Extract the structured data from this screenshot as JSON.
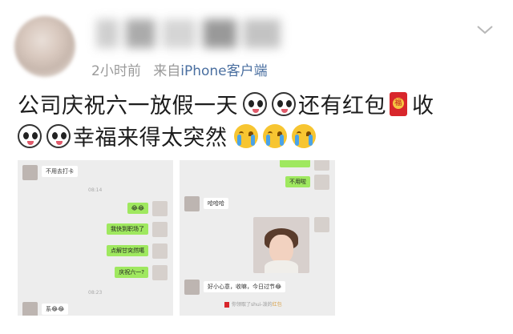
{
  "post": {
    "time": "2小时前",
    "source_prefix": "来自",
    "source_app": "iPhone客户端",
    "line1_a": "公司庆祝六一放假一天",
    "line1_b": "还有红包",
    "line1_c": "收",
    "line2": "幸福来得太突然"
  },
  "chat_left": {
    "msg1": "不用去打卡",
    "time1": "08:14",
    "msg2": "😂😂",
    "msg3": "我快到职场了",
    "msg4": "点解甘突然噶",
    "msg5": "庆祝六一?",
    "time2": "08:23",
    "msg6": "系😂😂"
  },
  "chat_right": {
    "msg1": "不用啦",
    "msg2": "哈哈哈",
    "msg3": "好小心意，收嘛，今日过节😂",
    "notice_prefix": "你领取了shui-泼的",
    "notice_link": "红包"
  },
  "icons": [
    "chevron-down-icon",
    "panda-emoji-icon",
    "crying-emoji-icon",
    "red-envelope-icon"
  ],
  "colors": {
    "link": "#4a6fa0",
    "bubble_green": "#9fe85f",
    "red_envelope": "#d8262b"
  }
}
